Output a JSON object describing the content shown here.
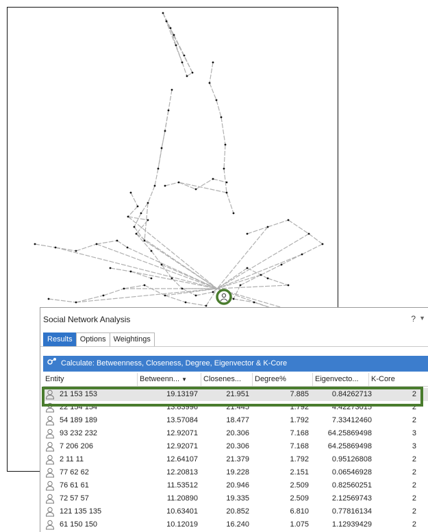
{
  "panel": {
    "title": "Social Network Analysis",
    "help": "?",
    "menu": "▼",
    "tabs": [
      {
        "label": "Results",
        "active": true
      },
      {
        "label": "Options",
        "active": false
      },
      {
        "label": "Weightings",
        "active": false
      }
    ],
    "calculate_label": "Calculate: Betweenness, Closeness, Degree, Eigenvector & K-Core",
    "columns": [
      "Entity",
      "Betweenn...",
      "Closenes...",
      "Degree%",
      "Eigenvecto...",
      "K-Core"
    ],
    "sort_indicator": "▼",
    "rows": [
      {
        "entity": "21 153 153",
        "betweenness": "19.13197",
        "closeness": "21.951",
        "degree": "7.885",
        "eigenvector": "0.84262713",
        "kcore": "2",
        "selected": true
      },
      {
        "entity": "22 154 154",
        "betweenness": "13.83996",
        "closeness": "21.445",
        "degree": "1.792",
        "eigenvector": "4.42273015",
        "kcore": "2",
        "selected": false
      },
      {
        "entity": "54 189 189",
        "betweenness": "13.57084",
        "closeness": "18.477",
        "degree": "1.792",
        "eigenvector": "7.33412460",
        "kcore": "2",
        "selected": false
      },
      {
        "entity": "93 232 232",
        "betweenness": "12.92071",
        "closeness": "20.306",
        "degree": "7.168",
        "eigenvector": "64.25869498",
        "kcore": "3",
        "selected": false
      },
      {
        "entity": "7 206 206",
        "betweenness": "12.92071",
        "closeness": "20.306",
        "degree": "7.168",
        "eigenvector": "64.25869498",
        "kcore": "3",
        "selected": false
      },
      {
        "entity": "2 11 11",
        "betweenness": "12.64107",
        "closeness": "21.379",
        "degree": "1.792",
        "eigenvector": "0.95126808",
        "kcore": "2",
        "selected": false
      },
      {
        "entity": "77 62 62",
        "betweenness": "12.20813",
        "closeness": "19.228",
        "degree": "2.151",
        "eigenvector": "0.06546928",
        "kcore": "2",
        "selected": false
      },
      {
        "entity": "76 61 61",
        "betweenness": "11.53512",
        "closeness": "20.946",
        "degree": "2.509",
        "eigenvector": "0.82560251",
        "kcore": "2",
        "selected": false
      },
      {
        "entity": "72 57 57",
        "betweenness": "11.20890",
        "closeness": "19.335",
        "degree": "2.509",
        "eigenvector": "2.12569743",
        "kcore": "2",
        "selected": false
      },
      {
        "entity": "121 135 135",
        "betweenness": "10.63401",
        "closeness": "20.852",
        "degree": "6.810",
        "eigenvector": "0.77816134",
        "kcore": "2",
        "selected": false
      },
      {
        "entity": "61 150 150",
        "betweenness": "10.12019",
        "closeness": "16.240",
        "degree": "1.075",
        "eigenvector": "1.12939429",
        "kcore": "2",
        "selected": false
      }
    ]
  },
  "colors": {
    "accent": "#3c7dcd",
    "highlight": "#4a7c2e",
    "edge": "#b0b0b0"
  },
  "icons": {
    "calculate": "network-calc-icon",
    "entity": "person-icon",
    "selected_node": "selected-node-icon"
  }
}
